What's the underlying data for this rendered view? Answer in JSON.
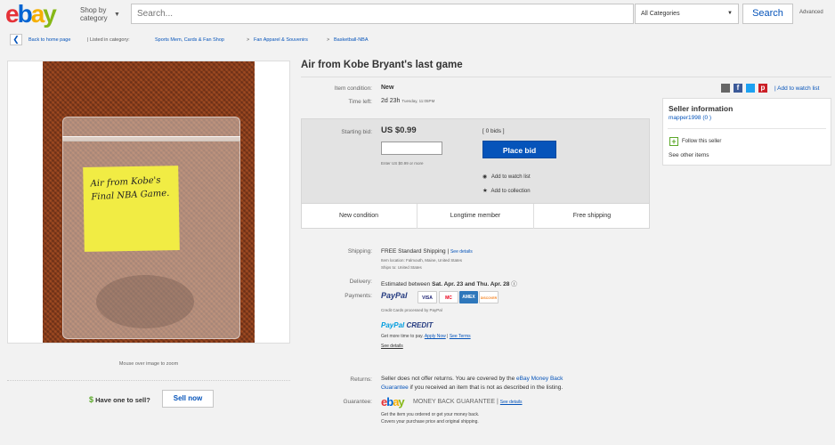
{
  "header": {
    "logo": {
      "e": "e",
      "b": "b",
      "a": "a",
      "y": "y"
    },
    "shop_by_line1": "Shop by",
    "shop_by_line2": "category",
    "search_placeholder": "Search...",
    "category_selected": "All Categories",
    "search_button": "Search",
    "advanced": "Advanced"
  },
  "breadcrumb": {
    "back": "Back to home page",
    "listed_in": "| Listed in category:",
    "items": [
      "Sports Mem, Cards & Fan Shop",
      "Fan Apparel & Souvenirs",
      "Basketball-NBA"
    ],
    "sep": ">"
  },
  "image": {
    "note_text": "Air from Kobe's Final NBA Game.",
    "mouse_hint": "Mouse over image to zoom"
  },
  "sell": {
    "dollar": "$",
    "have_one": "Have one to sell?",
    "sell_now": "Sell now"
  },
  "listing": {
    "title": "Air from Kobe Bryant's last game",
    "condition_label": "Item condition:",
    "condition_value": "New",
    "time_left_label": "Time left:",
    "time_left_value": "2d 23h",
    "time_left_detail": "Tuesday, 11:05PM",
    "add_watch_top": "Add to watch list",
    "starting_bid_label": "Starting bid:",
    "starting_bid_value": "US $0.99",
    "bids_link": "[ 0 bids ]",
    "place_bid": "Place bid",
    "enter_hint": "Enter US $0.99 or more",
    "add_watch": "Add to watch list",
    "add_collection": "Add to collection",
    "features": [
      "New condition",
      "Longtime member",
      "Free shipping"
    ]
  },
  "seller": {
    "title": "Seller information",
    "name": "mapper1998",
    "score": "(0 )",
    "follow": "Follow this seller",
    "other_items": "See other items"
  },
  "shipping": {
    "label": "Shipping:",
    "value": "FREE  Standard Shipping",
    "see_details": "See details",
    "location": "Item location:  Falmouth, Maine, United States",
    "ships_to": "Ships to:  United States",
    "delivery_label": "Delivery:",
    "delivery_prefix": "Estimated between",
    "delivery_dates": "Sat. Apr. 23 and Thu. Apr. 28",
    "payments_label": "Payments:",
    "paypal": "PayPal",
    "cards": [
      "VISA",
      "MC",
      "AMEX",
      "DISCOVER"
    ],
    "cc_processed": "Credit Cards processed by PayPal",
    "paypal_credit_1": "PayPal",
    "paypal_credit_2": "CREDIT",
    "more_time": "Get more time to pay.",
    "apply_now": "Apply Now",
    "see_terms": "See Terms",
    "see_details2": "See details",
    "returns_label": "Returns:",
    "returns_line1a": "Seller does not offer returns. You are covered by the",
    "returns_link": "eBay Money Back",
    "returns_line2a": "Guarantee",
    "returns_line2b": "if you received an item that is not as described in the listing.",
    "guarantee_label": "Guarantee:",
    "mbg_text": "MONEY BACK GUARANTEE",
    "mbg_details": "See details",
    "guarantee_line1": "Get the item you ordered or get your money back.",
    "guarantee_line2": "Covers your purchase price and original shipping."
  },
  "colors": {
    "link": "#0654ba",
    "ebay_red": "#e53238",
    "ebay_blue": "#0064d2",
    "ebay_yellow": "#f5af02",
    "ebay_green": "#86b817"
  }
}
